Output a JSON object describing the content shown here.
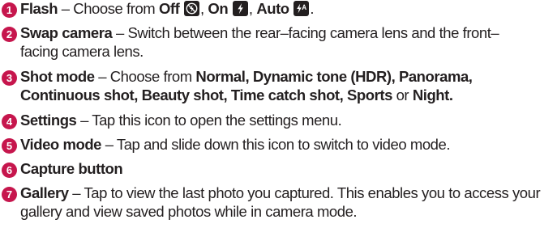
{
  "items": [
    {
      "number": "1",
      "label": "Flash",
      "desc": " – Choose from ",
      "opt_off": "Off",
      "opt_on": "On",
      "opt_auto": "Auto",
      "icon_off": "flash-off-icon",
      "icon_on": "flash-on-icon",
      "icon_auto": "flash-auto-icon"
    },
    {
      "number": "2",
      "label": "Swap camera",
      "desc": " – Switch between the rear–facing camera lens and the front–",
      "desc2": "facing camera lens."
    },
    {
      "number": "3",
      "label": "Shot mode",
      "desc": " – Choose from ",
      "modes_line1": "Normal, Dynamic tone (HDR), Panorama,",
      "modes_line2": "Continuous shot, Beauty shot, Time catch shot, Sports",
      "or": " or ",
      "night": "Night."
    },
    {
      "number": "4",
      "label": "Settings",
      "desc": " – Tap this icon to open the settings menu."
    },
    {
      "number": "5",
      "label": "Video mode",
      "desc": " –  Tap and slide down this icon to switch to video mode."
    },
    {
      "number": "6",
      "label": "Capture button"
    },
    {
      "number": "7",
      "label": "Gallery",
      "desc": " – Tap to view the last photo you captured. This enables you to access your",
      "desc2": "gallery and view saved photos while in camera mode."
    }
  ],
  "colors": {
    "number_badge": "#c6164d",
    "text": "#231f20",
    "icon_bg": "#231f20"
  }
}
